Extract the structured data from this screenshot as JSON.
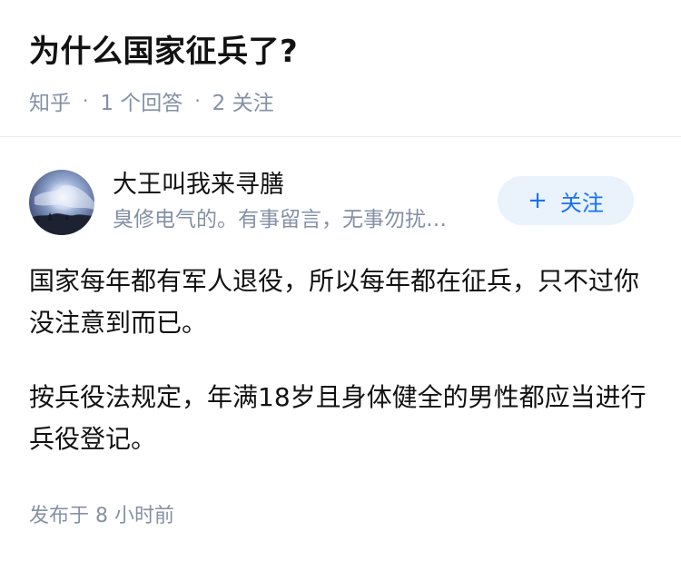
{
  "question": {
    "title": "为什么国家征兵了?",
    "source": "知乎",
    "answer_count": "1 个回答",
    "follow_count": "2 关注"
  },
  "answer": {
    "author": {
      "name": "大王叫我来寻膳",
      "bio": "臭修电气的。有事留言，无事勿扰…",
      "avatar_icon": "avatar-sky-clouds"
    },
    "follow_button": {
      "icon": "+",
      "label": "关注"
    },
    "paragraphs": [
      "国家每年都有军人退役，所以每年都在征兵，只不过你没注意到而已。",
      "按兵役法规定，年满18岁且身体健全的男性都应当进行兵役登记。"
    ],
    "published": "发布于 8 小时前"
  },
  "colors": {
    "accent": "#1772f6",
    "accent_bg": "#eaf2fc",
    "meta_text": "#8590a6",
    "main_text": "#121212"
  }
}
